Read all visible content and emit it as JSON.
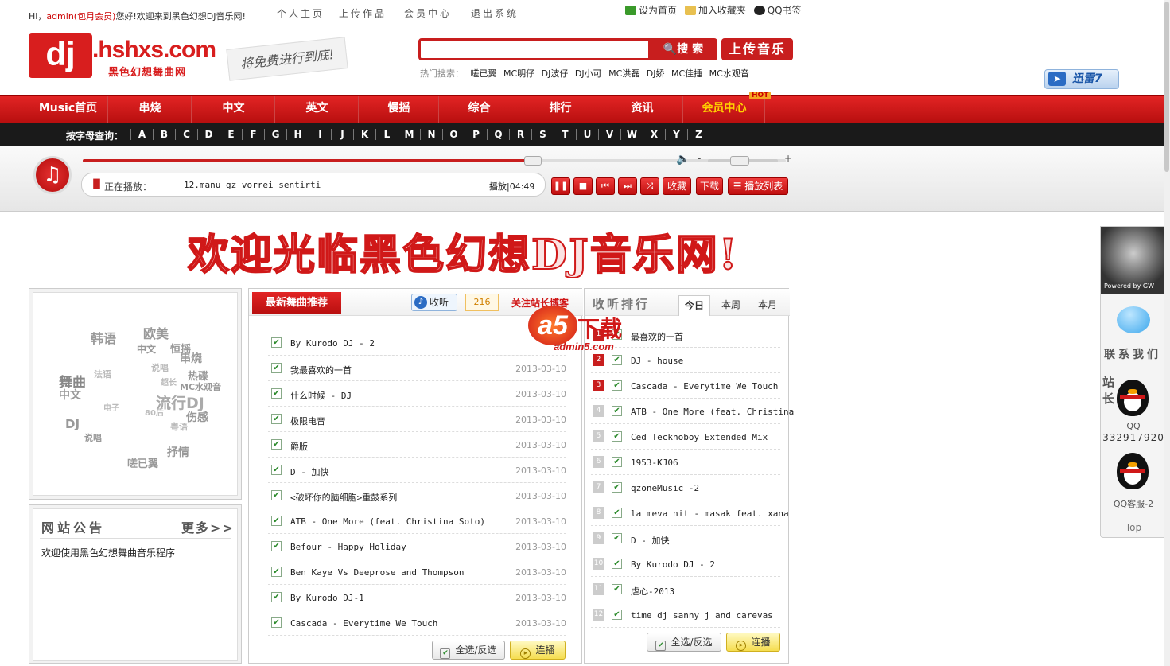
{
  "top": {
    "greeting_pre": "Hi，",
    "user": "admin(包月会员)",
    "greeting_post": "您好!欢迎来到黑色幻想DJ音乐网!",
    "links": [
      "个人主页",
      "上传作品",
      "会员中心",
      "退出系统"
    ],
    "right_links": [
      "设为首页",
      "加入收藏夹",
      "QQ书签"
    ]
  },
  "logo": {
    "dj": "dj",
    "site": ".hshxs.com",
    "subtitle": "黑色幻想舞曲网",
    "slogan": "将免费进行到底!"
  },
  "search": {
    "placeholder": "",
    "button": "搜 索",
    "upload": "上传音乐",
    "hot_label": "热门搜索：",
    "hot": [
      "嗟已翼",
      "MC明仔",
      "DJ波仔",
      "DJ小可",
      "MC洪磊",
      "DJ娇",
      "MC佳捶",
      "MC水观音"
    ]
  },
  "xunlei": "迅雷7",
  "nav": {
    "items": [
      "Music首页",
      "串烧",
      "中文",
      "英文",
      "慢摇",
      "综合",
      "排行",
      "资讯",
      "会员中心"
    ],
    "hot_badge": "HOT"
  },
  "letters": {
    "label": "按字母查询：",
    "items": [
      "A",
      "B",
      "C",
      "D",
      "E",
      "F",
      "G",
      "H",
      "I",
      "J",
      "K",
      "L",
      "M",
      "N",
      "O",
      "P",
      "Q",
      "R",
      "S",
      "T",
      "U",
      "V",
      "W",
      "X",
      "Y",
      "Z"
    ]
  },
  "player": {
    "now_label": "正在播放：",
    "song": "12.manu gz vorrei sentirti",
    "status": "播放|04:49",
    "progress": 0.64,
    "volume": 0.45,
    "vol_minus": "-",
    "vol_plus": "+",
    "buttons": [
      "收藏",
      "下载",
      "播放列表"
    ]
  },
  "banner": "欢迎光临黑色幻想DJ音乐网!",
  "tags": [
    "韩语",
    "欧美",
    "中文",
    "恒摇",
    "串烧",
    "热碟",
    "MC水观音",
    "流行DJ",
    "伤感",
    "舞曲",
    "中文",
    "DJ",
    "说唱",
    "抒情",
    "嗟已翼",
    "电子",
    "80后",
    "粤语",
    "法语",
    "说唱",
    "超长"
  ],
  "notice": {
    "title": "网站公告",
    "more": "更多>>",
    "text": "欢迎使用黑色幻想舞曲音乐程序"
  },
  "list": {
    "title": "最新舞曲推荐",
    "listen": "收听",
    "count": "216",
    "follow": "关注站长博客",
    "rows": [
      {
        "title": "By Kurodo DJ - 2",
        "date": "20"
      },
      {
        "title": "我最喜欢的一首",
        "date": "2013-03-10"
      },
      {
        "title": "什么时候 - DJ",
        "date": "2013-03-10"
      },
      {
        "title": "极限电音",
        "date": "2013-03-10"
      },
      {
        "title": "爵版",
        "date": "2013-03-10"
      },
      {
        "title": "D - 加快",
        "date": "2013-03-10"
      },
      {
        "title": "<破坏你的脑细胞>重鼓系列",
        "date": "2013-03-10"
      },
      {
        "title": "ATB - One More (feat. Christina Soto)",
        "date": "2013-03-10"
      },
      {
        "title": "Befour - Happy Holiday",
        "date": "2013-03-10"
      },
      {
        "title": "Ben Kaye Vs Deeprose and Thompson",
        "date": "2013-03-10"
      },
      {
        "title": "By Kurodo DJ-1",
        "date": "2013-03-10"
      },
      {
        "title": "Cascada - Everytime We Touch",
        "date": "2013-03-10"
      }
    ],
    "select_all": "全选/反选",
    "play": "连播"
  },
  "rank": {
    "title": "收听排行",
    "tabs": [
      "今日",
      "本周",
      "本月"
    ],
    "rows": [
      {
        "n": "1",
        "title": "最喜欢的一首"
      },
      {
        "n": "2",
        "title": "DJ - house"
      },
      {
        "n": "3",
        "title": "Cascada - Everytime We Touch"
      },
      {
        "n": "4",
        "title": "ATB - One More (feat. Christina"
      },
      {
        "n": "5",
        "title": "Ced Tecknoboy Extended Mix"
      },
      {
        "n": "6",
        "title": "1953-KJ06"
      },
      {
        "n": "7",
        "title": "qzoneMusic -2"
      },
      {
        "n": "8",
        "title": "la meva nit - masak feat. xana"
      },
      {
        "n": "9",
        "title": "D - 加快"
      },
      {
        "n": "10",
        "title": "By Kurodo DJ - 2"
      },
      {
        "n": "11",
        "title": "虐心-2013"
      },
      {
        "n": "12",
        "title": "time dj sanny j and carevas"
      }
    ],
    "select_all": "全选/反选",
    "play": "连播"
  },
  "watermark": {
    "a": "a5",
    "text": "下载",
    "url": "admin5.com"
  },
  "side": {
    "powered": "Powered by GW",
    "contact": "联系我们",
    "owner": "站长",
    "qq_label": "QQ",
    "qq_number": "332917920",
    "qq2": "QQ客服-2",
    "top": "Top"
  }
}
